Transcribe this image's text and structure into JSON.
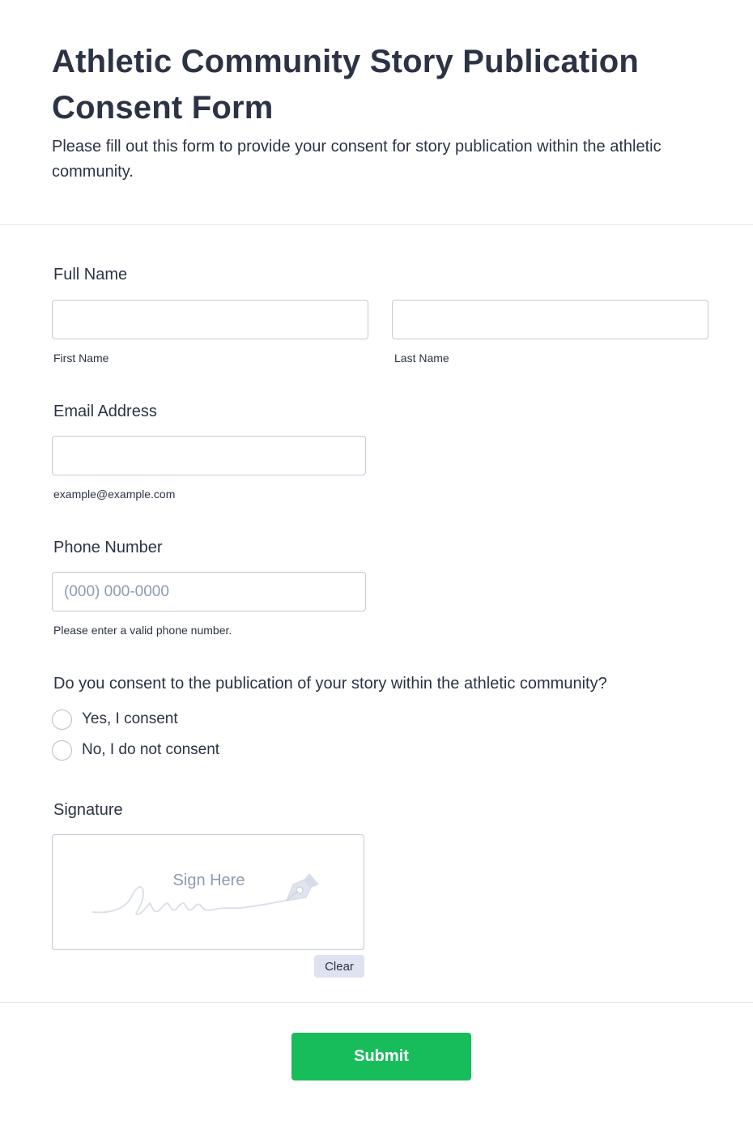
{
  "header": {
    "title": "Athletic Community Story Publication Consent Form",
    "subtitle": "Please fill out this form to provide your consent for story publication within the athletic community."
  },
  "full_name": {
    "label": "Full Name",
    "first_value": "",
    "first_sublabel": "First Name",
    "last_value": "",
    "last_sublabel": "Last Name"
  },
  "email": {
    "label": "Email Address",
    "value": "",
    "sublabel": "example@example.com"
  },
  "phone": {
    "label": "Phone Number",
    "placeholder": "(000) 000-0000",
    "sublabel": "Please enter a valid phone number."
  },
  "consent": {
    "question": "Do you consent to the publication of your story within the athletic community?",
    "options": [
      {
        "label": "Yes, I consent",
        "selected": false
      },
      {
        "label": "No, I do not consent",
        "selected": false
      }
    ]
  },
  "signature": {
    "label": "Signature",
    "prompt": "Sign Here",
    "clear_label": "Clear",
    "icon": "pen-nib-icon"
  },
  "submit": {
    "label": "Submit",
    "color": "#18bd5b"
  }
}
